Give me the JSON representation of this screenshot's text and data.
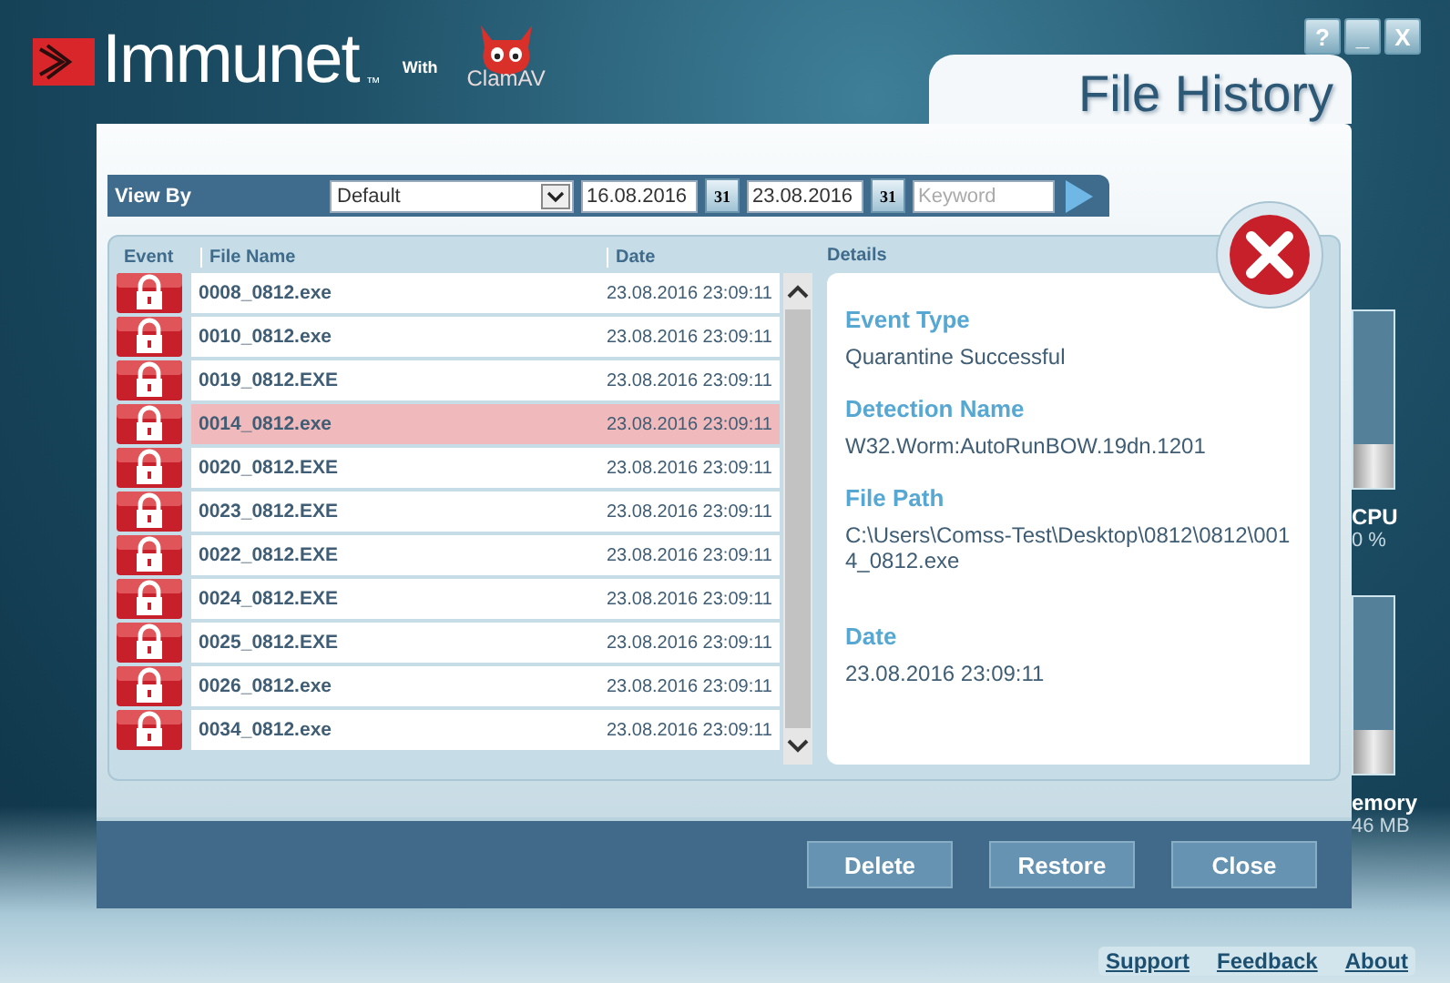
{
  "app": {
    "logo": "Immunet",
    "trademark": "™",
    "with": "With",
    "partner": "ClamAV"
  },
  "window_controls": [
    "?",
    "_",
    "X"
  ],
  "meters": [
    {
      "label": "CPU",
      "reading": "0 %",
      "level": 0.25
    },
    {
      "label": "emory",
      "reading": "46 MB",
      "level": 0.25
    }
  ],
  "dialog": {
    "title": "File History",
    "toolbar": {
      "label": "View By",
      "view": "Default",
      "from": {
        "value": "16.08.2016",
        "calendar": "31"
      },
      "to": {
        "value": "23.08.2016",
        "calendar": "31"
      },
      "keyword": {
        "placeholder": "Keyword"
      }
    },
    "table": {
      "columns": [
        "Event",
        "File Name",
        "Date"
      ],
      "rows": [
        {
          "name": "0008_0812.exe",
          "date": "23.08.2016 23:09:11",
          "selected": false
        },
        {
          "name": "0010_0812.exe",
          "date": "23.08.2016 23:09:11",
          "selected": false
        },
        {
          "name": "0019_0812.EXE",
          "date": "23.08.2016 23:09:11",
          "selected": false
        },
        {
          "name": "0014_0812.exe",
          "date": "23.08.2016 23:09:11",
          "selected": true
        },
        {
          "name": "0020_0812.EXE",
          "date": "23.08.2016 23:09:11",
          "selected": false
        },
        {
          "name": "0023_0812.EXE",
          "date": "23.08.2016 23:09:11",
          "selected": false
        },
        {
          "name": "0022_0812.EXE",
          "date": "23.08.2016 23:09:11",
          "selected": false
        },
        {
          "name": "0024_0812.EXE",
          "date": "23.08.2016 23:09:11",
          "selected": false
        },
        {
          "name": "0025_0812.EXE",
          "date": "23.08.2016 23:09:11",
          "selected": false
        },
        {
          "name": "0026_0812.exe",
          "date": "23.08.2016 23:09:11",
          "selected": false
        },
        {
          "name": "0034_0812.exe",
          "date": "23.08.2016 23:09:11",
          "selected": false
        }
      ]
    },
    "details": {
      "heading": "Details",
      "fields": [
        {
          "label": "Event Type",
          "value": "Quarantine Successful"
        },
        {
          "label": "Detection Name",
          "value": "W32.Worm:AutoRunBOW.19dn.1201"
        },
        {
          "label": "File Path",
          "value": "C:\\Users\\Comss-Test\\Desktop\\0812\\0812\\0014_0812.exe"
        },
        {
          "label": "Date",
          "value": "23.08.2016 23:09:11"
        }
      ]
    },
    "buttons": [
      "Delete",
      "Restore",
      "Close"
    ]
  },
  "footer_links": [
    "Support",
    "Feedback",
    "About"
  ]
}
